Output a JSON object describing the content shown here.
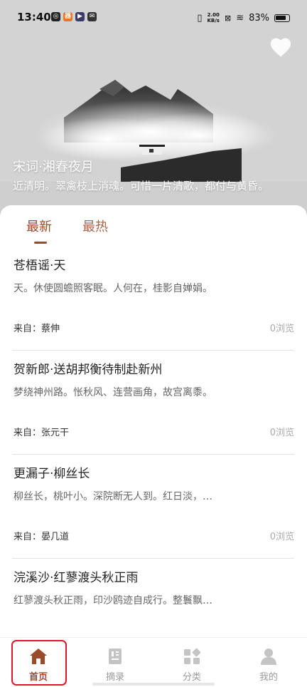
{
  "status_bar": {
    "time": "13:40",
    "net_speed_value": "2.00",
    "net_speed_unit": "KB/s",
    "battery": "83%"
  },
  "hero": {
    "title": "宋词·湘春夜月",
    "excerpt": "近清明。翠禽枝上消魂。可惜一片清歌，都付与黄昏。"
  },
  "tabs": [
    {
      "label": "最新",
      "active": true
    },
    {
      "label": "最热",
      "active": false
    }
  ],
  "poems": [
    {
      "title": "苍梧谣·天",
      "excerpt": "天。休使圆蟾照客眠。人何在，桂影自婵娟。",
      "author": "来自：蔡伸",
      "views": "0浏览"
    },
    {
      "title": "贺新郎·送胡邦衡待制赴新州",
      "excerpt": "梦绕神州路。怅秋风、连营画角，故宫离黍。",
      "author": "来自：张元干",
      "views": "0浏览"
    },
    {
      "title": "更漏子·柳丝长",
      "excerpt": "柳丝长，桃叶小。深院断无人到。红日淡，绿烟晴。",
      "author": "来自：晏几道",
      "views": "0浏览"
    },
    {
      "title": "浣溪沙·红蓼渡头秋正雨",
      "excerpt": "红蓼渡头秋正雨，印沙鸥迹自成行。整鬟飘袖野风香。",
      "author": "",
      "views": ""
    }
  ],
  "bottom_nav": [
    {
      "label": "首页",
      "icon": "home-icon",
      "active": true
    },
    {
      "label": "摘录",
      "icon": "notebook-icon",
      "active": false
    },
    {
      "label": "分类",
      "icon": "category-icon",
      "active": false
    },
    {
      "label": "我的",
      "icon": "profile-icon",
      "active": false
    }
  ],
  "colors": {
    "accent": "#9b4a2a",
    "accent_light": "#a56745",
    "highlight_box": "#e0162b",
    "nav_inactive": "#9a9a9a"
  }
}
